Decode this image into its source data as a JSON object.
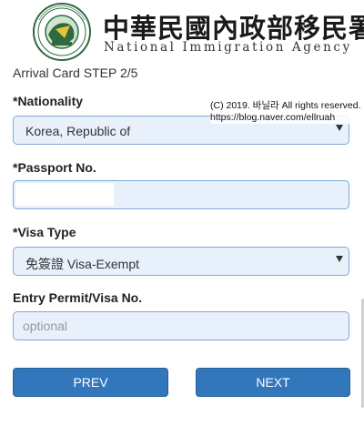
{
  "header": {
    "agency_cn": "中華民國內政部移民署",
    "agency_en": "National Immigration Agency",
    "logo_ring_text": "內政部移民署 National Immigration Agency",
    "brand_color": "#2d6a3f"
  },
  "step_title": "Arrival Card STEP 2/5",
  "watermark": {
    "line1": "(C) 2019. 바닐라 All rights reserved.",
    "line2": "https://blog.naver.com/ellruah"
  },
  "form": {
    "nationality": {
      "label": "*Nationality",
      "value": "Korea, Republic of",
      "icon": "caret-down-icon"
    },
    "passport": {
      "label": "*Passport No.",
      "value": ""
    },
    "visa_type": {
      "label": "*Visa Type",
      "value": "免簽證 Visa-Exempt",
      "icon": "caret-down-icon"
    },
    "entry_permit": {
      "label": "Entry Permit/Visa No.",
      "placeholder": "optional",
      "value": ""
    }
  },
  "buttons": {
    "prev": "PREV",
    "next": "NEXT"
  },
  "colors": {
    "button_bg": "#3277bc",
    "field_bg": "#e8f0fb",
    "field_border": "#7fa9d8"
  }
}
